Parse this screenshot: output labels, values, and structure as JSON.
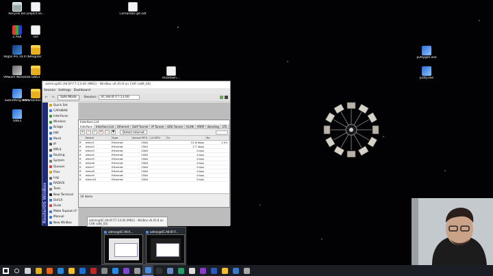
{
  "desktop": {
    "icons": [
      {
        "label": "Recycle Bin",
        "icon": "recycle-bin-icon",
        "kind": "ic-bin"
      },
      {
        "label": "project.se...",
        "icon": "document-icon",
        "kind": "ic-doc"
      },
      {
        "label": "Z ASK",
        "icon": "winzip-icon",
        "kind": "ic-zip"
      },
      {
        "label": "vse",
        "icon": "document-icon",
        "kind": "ic-doc"
      },
      {
        "label": "Vegas Pro 14.0 (64-bit)",
        "icon": "vegas-pro-icon",
        "kind": "ic-vegas"
      },
      {
        "label": "Angular",
        "icon": "folder-icon",
        "kind": "ic-folder"
      },
      {
        "label": "VMware Workstati...",
        "icon": "vmware-icon",
        "kind": "ic-vmw"
      },
      {
        "label": "GNS3",
        "icon": "folder-icon",
        "kind": "ic-folder"
      },
      {
        "label": "Subnetting APPS",
        "icon": "app-icon",
        "kind": "ic-app"
      },
      {
        "label": "Documentos mikrotik",
        "icon": "folder-icon",
        "kind": "ic-folder"
      },
      {
        "label": "GNS3",
        "icon": "gns3-icon",
        "kind": "ic-app"
      },
      {
        "label": "Comandos git.odt",
        "icon": "document-icon",
        "kind": "ic-doc"
      },
      {
        "label": "shutdown....",
        "icon": "shortcut-icon",
        "kind": "ic-doc"
      },
      {
        "label": "puttygen.exe",
        "icon": "puttygen-icon",
        "kind": "ic-app"
      },
      {
        "label": "putty.exe",
        "icon": "putty-icon",
        "kind": "ic-app"
      }
    ]
  },
  "winbox": {
    "title": "admin@0C:A8:0F:F7:13:00 (MKG) - WinBox v6.45.8 on CHR (x86_64)",
    "menu": [
      "Session",
      "Settings",
      "Dashboard"
    ],
    "safe_mode": "Safe Mode",
    "session_label": "Session:",
    "session_value": "0C:A8:0F:F7:13:00",
    "brand": "RouterOS WinBox",
    "nav": [
      {
        "label": "Quick Set",
        "color": "#d9a520"
      },
      {
        "label": "CAPsMAN",
        "color": "#4a7bd0"
      },
      {
        "label": "Interfaces",
        "color": "#3a9a3a"
      },
      {
        "label": "Wireless",
        "color": "#3a9a3a"
      },
      {
        "label": "Bridge",
        "color": "#3a7bd0"
      },
      {
        "label": "PPP",
        "color": "#3a7bd0"
      },
      {
        "label": "Mesh",
        "color": "#3a7bd0"
      },
      {
        "label": "IP",
        "color": "#555555"
      },
      {
        "label": "MPLS",
        "color": "#555555"
      },
      {
        "label": "Routing",
        "color": "#3a7bd0"
      },
      {
        "label": "System",
        "color": "#777777"
      },
      {
        "label": "Queues",
        "color": "#cc4444"
      },
      {
        "label": "Files",
        "color": "#d9a520"
      },
      {
        "label": "Log",
        "color": "#666666"
      },
      {
        "label": "RADIUS",
        "color": "#4a7bd0"
      },
      {
        "label": "Tools",
        "color": "#777777"
      },
      {
        "label": "New Terminal",
        "color": "#222222"
      },
      {
        "label": "Dot1X",
        "color": "#4a7bd0"
      },
      {
        "label": "Dude",
        "color": "#cc4444"
      },
      {
        "label": "Make Supout.rif",
        "color": "#4a7bd0"
      },
      {
        "label": "Manual",
        "color": "#3a7bd0"
      },
      {
        "label": "New WinBox",
        "color": "#3a7bd0"
      }
    ]
  },
  "interface_list": {
    "title": "Interface List",
    "tabs": [
      "Interface",
      "Interface List",
      "Ethernet",
      "EoIP Tunnel",
      "IP Tunnel",
      "GRE Tunnel",
      "VLAN",
      "VRRP",
      "Bonding",
      "LTE"
    ],
    "detect_label": "Detect Internet",
    "columns": [
      "Name",
      "Type",
      "Actual MTU",
      "L2 MTU",
      "Tx",
      "Rx"
    ],
    "rows": [
      {
        "flag": "R",
        "name": "ether1",
        "type": "Ethernet",
        "mtu": "1500",
        "l2": "",
        "tx": "51.6 kbps",
        "rx": "1.9 k"
      },
      {
        "flag": "R",
        "name": "ether2",
        "type": "Ethernet",
        "mtu": "1500",
        "l2": "",
        "tx": "2.7 kbps",
        "rx": ""
      },
      {
        "flag": "R",
        "name": "ether3",
        "type": "Ethernet",
        "mtu": "1500",
        "l2": "",
        "tx": "0 bps",
        "rx": ""
      },
      {
        "flag": "R",
        "name": "ether4",
        "type": "Ethernet",
        "mtu": "1500",
        "l2": "",
        "tx": "0 bps",
        "rx": ""
      },
      {
        "flag": "R",
        "name": "ether5",
        "type": "Ethernet",
        "mtu": "1500",
        "l2": "",
        "tx": "0 bps",
        "rx": ""
      },
      {
        "flag": "R",
        "name": "ether6",
        "type": "Ethernet",
        "mtu": "1500",
        "l2": "",
        "tx": "0 bps",
        "rx": ""
      },
      {
        "flag": "R",
        "name": "ether7",
        "type": "Ethernet",
        "mtu": "1500",
        "l2": "",
        "tx": "0 bps",
        "rx": ""
      },
      {
        "flag": "R",
        "name": "ether8",
        "type": "Ethernet",
        "mtu": "1500",
        "l2": "",
        "tx": "0 bps",
        "rx": ""
      },
      {
        "flag": "R",
        "name": "ether9",
        "type": "Ethernet",
        "mtu": "1500",
        "l2": "",
        "tx": "0 bps",
        "rx": ""
      },
      {
        "flag": "R",
        "name": "ether10",
        "type": "Ethernet",
        "mtu": "1500",
        "l2": "",
        "tx": "0 bps",
        "rx": ""
      }
    ],
    "status": "10 items"
  },
  "tooltip": {
    "text": "admin@0C:A8:0F:F7:13:00 (MKG) - WinBox v6.45.8 on CHR (x86_64)"
  },
  "thumbnails": [
    {
      "title": "admin@0C:A8:0..."
    },
    {
      "title": "admin@0C:A8:0F:F..."
    }
  ],
  "taskbar": {
    "items": [
      {
        "icon": "windows-start-icon",
        "color": "#ffffff"
      },
      {
        "icon": "search-icon",
        "color": "#cfd3d8"
      },
      {
        "icon": "task-view-icon",
        "color": "#cfd3d8"
      },
      {
        "icon": "chrome-icon",
        "color": "#e0b020"
      },
      {
        "icon": "firefox-icon",
        "color": "#e8661a"
      },
      {
        "icon": "edge-icon",
        "color": "#2a86d6"
      },
      {
        "icon": "file-explorer-icon",
        "color": "#f0c030"
      },
      {
        "icon": "teamviewer-icon",
        "color": "#1e6fd0"
      },
      {
        "icon": "filezilla-icon",
        "color": "#c02828"
      },
      {
        "icon": "terminal-icon",
        "color": "#888888"
      },
      {
        "icon": "vscode-icon",
        "color": "#2a8ae0"
      },
      {
        "icon": "visual-studio-icon",
        "color": "#7a4ac8"
      },
      {
        "icon": "vmware-icon",
        "color": "#9a9a9a"
      },
      {
        "icon": "winbox-icon",
        "color": "#4a8ad8"
      },
      {
        "icon": "cmd-icon",
        "color": "#333333"
      },
      {
        "icon": "putty-icon",
        "color": "#6a8ac0"
      },
      {
        "icon": "gns3-icon",
        "color": "#2a9a6a"
      },
      {
        "icon": "obs-icon",
        "color": "#dddddd"
      },
      {
        "icon": "onenote-icon",
        "color": "#8a3ac8"
      },
      {
        "icon": "word-icon",
        "color": "#2a5ab8"
      },
      {
        "icon": "folder-icon",
        "color": "#f0c030"
      },
      {
        "icon": "wireshark-icon",
        "color": "#3a78c8"
      },
      {
        "icon": "notepad-icon",
        "color": "#aaaaaa"
      }
    ]
  }
}
